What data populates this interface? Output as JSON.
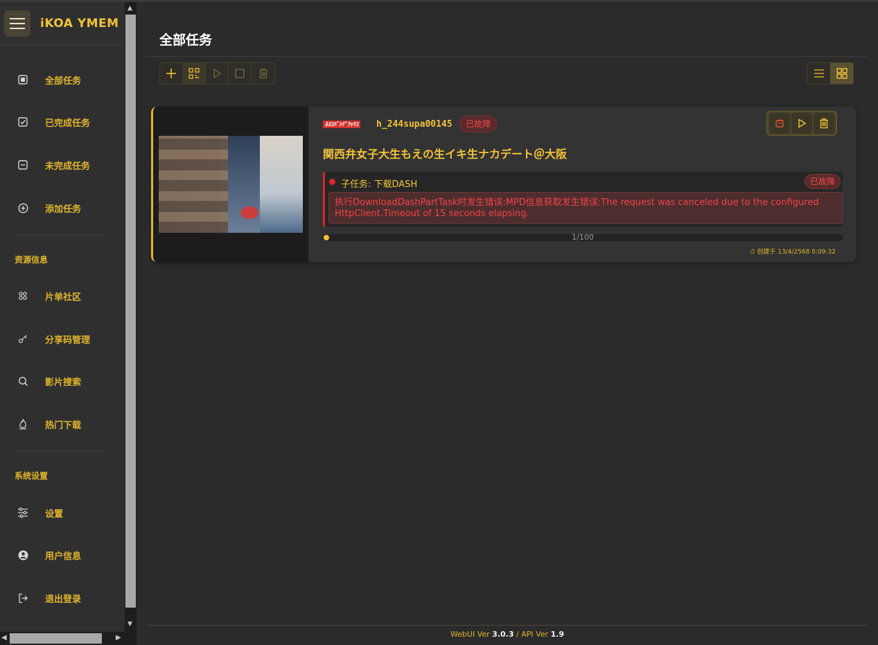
{
  "app": {
    "title": "iKOA YMEM"
  },
  "sidebar": {
    "items": [
      {
        "label": "全部任务",
        "icon": "square-icon"
      },
      {
        "label": "已完成任务",
        "icon": "checkbox-icon"
      },
      {
        "label": "未完成任务",
        "icon": "minus-square-icon"
      },
      {
        "label": "添加任务",
        "icon": "plus-circle-icon"
      },
      {
        "label": "片单社区",
        "icon": "community-icon"
      },
      {
        "label": "分享码管理",
        "icon": "key-icon"
      },
      {
        "label": "影片搜索",
        "icon": "search-icon"
      },
      {
        "label": "热门下载",
        "icon": "fire-icon"
      },
      {
        "label": "设置",
        "icon": "sliders-icon"
      },
      {
        "label": "用户信息",
        "icon": "user-circle-icon"
      },
      {
        "label": "退出登录",
        "icon": "logout-icon"
      }
    ],
    "sections": {
      "resources": "资源信息",
      "system": "系统设置"
    }
  },
  "main": {
    "title": "全部任务",
    "toolbar": [
      "add-icon",
      "qr-icon",
      "play-icon",
      "stop-icon",
      "trash-icon"
    ],
    "view": {
      "list": "list-icon",
      "grid": "grid-icon",
      "active": "grid"
    }
  },
  "task": {
    "studio": "Rakuten Studio",
    "code": "h_244supa00145",
    "status": "已故障",
    "title": "関西弁女子大生もえの生イキ生ナカデート＠大阪",
    "subtask": {
      "label": "子任务: 下载DASH",
      "status": "已故障",
      "error": "执行DownloadDashPartTask时发生错误:MPD信息获取发生错误:The request was canceled due to the configured HttpClient.Timeout of 15 seconds elapsing."
    },
    "progress": {
      "text": "1/100",
      "fraction": 0.01
    },
    "created": "创建于 13/4/2568 0:09:32"
  },
  "footer": {
    "webui_label": "WebUI Ver ",
    "webui_ver": "3.0.3",
    "api_label": " / API Ver ",
    "api_ver": "1.9"
  },
  "colors": {
    "accent": "#f2c438",
    "error": "#ef4444",
    "background": "#2b2b2b"
  }
}
